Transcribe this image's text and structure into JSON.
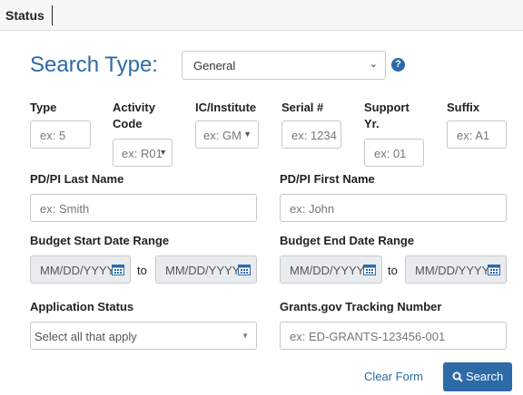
{
  "header": {
    "title": "Status"
  },
  "search": {
    "label": "Search Type:",
    "type_value": "General"
  },
  "fields": {
    "type": {
      "label": "Type",
      "placeholder": "ex: 5"
    },
    "activity_code": {
      "label_line1": "Activity",
      "label_line2": "Code",
      "placeholder": "ex: R01"
    },
    "ic_institute": {
      "label": "IC/Institute",
      "placeholder": "ex: GM"
    },
    "serial": {
      "label": "Serial #",
      "placeholder": "ex: 1234"
    },
    "support_yr": {
      "label_line1": "Support",
      "label_line2": "Yr.",
      "placeholder": "ex: 01"
    },
    "suffix": {
      "label": "Suffix",
      "placeholder": "ex: A1"
    },
    "pd_pi_last": {
      "label": "PD/PI Last Name",
      "placeholder": "ex: Smith"
    },
    "pd_pi_first": {
      "label": "PD/PI First Name",
      "placeholder": "ex: John"
    },
    "budget_start": {
      "label": "Budget Start Date Range",
      "from_placeholder": "MM/DD/YYYY",
      "to_label": "to",
      "to_placeholder": "MM/DD/YYYY"
    },
    "budget_end": {
      "label": "Budget End Date Range",
      "from_placeholder": "MM/DD/YYYY",
      "to_label": "to",
      "to_placeholder": "MM/DD/YYYY"
    },
    "application_status": {
      "label": "Application Status",
      "placeholder": "Select all that apply"
    },
    "tracking_number": {
      "label": "Grants.gov Tracking Number",
      "placeholder": "ex: ED-GRANTS-123456-001"
    }
  },
  "actions": {
    "clear_label": "Clear Form",
    "search_label": "Search"
  },
  "colors": {
    "accent": "#2d6aa8",
    "disabled_bg": "#e9ecef",
    "border": "#c8c8c8"
  },
  "icons": [
    "question-circle-icon",
    "calendar-icon",
    "chevron-down-icon",
    "search-icon"
  ]
}
